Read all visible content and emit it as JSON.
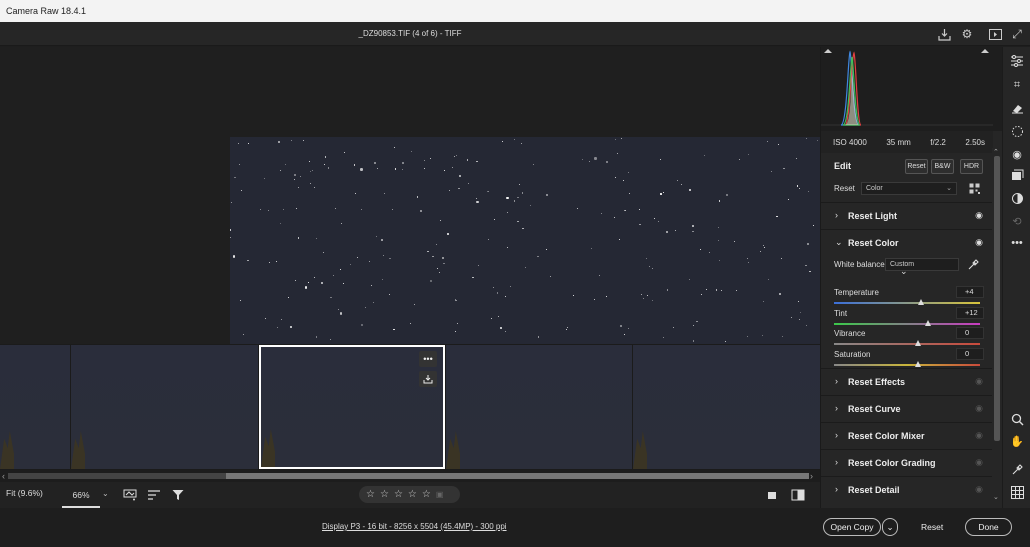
{
  "app": {
    "title": "Camera Raw 18.4.1"
  },
  "header": {
    "doc_title": "_DZ90853.TIF (4 of 6)  -  TIFF"
  },
  "exif": {
    "iso": "ISO 4000",
    "focal": "35 mm",
    "aperture": "f/2.2",
    "shutter": "2.50s"
  },
  "edit": {
    "title": "Edit",
    "reset_label": "Reset",
    "bw_label": "B&W",
    "hdr_label": "HDR",
    "profile_label": "Reset",
    "profile_value": "Color"
  },
  "sections": {
    "light": "Reset Light",
    "color": "Reset Color",
    "effects": "Reset Effects",
    "curve": "Reset Curve",
    "mixer": "Reset Color Mixer",
    "grading": "Reset Color Grading",
    "detail": "Reset Detail"
  },
  "color_panel": {
    "wb_label": "White balance",
    "wb_value": "Custom",
    "sliders": [
      {
        "name": "Temperature",
        "value": "+4",
        "position": 0.6
      },
      {
        "name": "Tint",
        "value": "+12",
        "position": 0.65
      },
      {
        "name": "Vibrance",
        "value": "0",
        "position": 0.58
      },
      {
        "name": "Saturation",
        "value": "0",
        "position": 0.58
      }
    ]
  },
  "zoom": {
    "fit": "Fit (9.6%)",
    "percent": "66%"
  },
  "footer": {
    "display_info": "Display P3 - 16 bit - 8256 x 5504 (45.4MP) - 300 ppi",
    "open_copy": "Open Copy",
    "reset": "Reset",
    "done": "Done"
  },
  "rating": {
    "stars": 5
  },
  "colors": {
    "accent": "#ffffff",
    "panel": "#262626",
    "photo": "#252834"
  }
}
